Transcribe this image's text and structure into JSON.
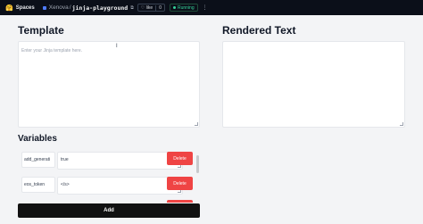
{
  "topbar": {
    "spaces_label": "Spaces",
    "owner": "Xenova",
    "separator": "/",
    "repo": "jinja-playground",
    "like_label": "like",
    "like_count": "0",
    "status": "Running",
    "more": "⋮"
  },
  "template": {
    "title": "Template",
    "placeholder": "Enter your Jinja template here."
  },
  "rendered": {
    "title": "Rendered Text"
  },
  "variables": {
    "title": "Variables",
    "rows": [
      {
        "key": "add_generati",
        "value": "true",
        "delete_label": "Delete"
      },
      {
        "key": "eos_token",
        "value": "</s>",
        "delete_label": "Delete"
      }
    ],
    "add_label": "Add"
  },
  "colors": {
    "topbar_bg": "#0b0f19",
    "delete_red": "#ef4444",
    "add_black": "#111111",
    "running_green": "#34d399"
  }
}
